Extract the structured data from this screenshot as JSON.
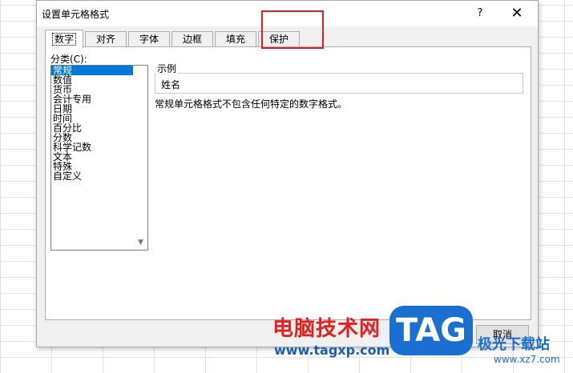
{
  "dialog": {
    "title": "设置单元格格式",
    "help": "?",
    "close": "✕"
  },
  "tabs": [
    {
      "label": "数字",
      "active": true
    },
    {
      "label": "对齐"
    },
    {
      "label": "字体"
    },
    {
      "label": "边框"
    },
    {
      "label": "填充"
    },
    {
      "label": "保护"
    }
  ],
  "category": {
    "label": "分类(C):",
    "items": [
      "常规",
      "数值",
      "货币",
      "会计专用",
      "日期",
      "时间",
      "百分比",
      "分数",
      "科学记数",
      "文本",
      "特殊",
      "自定义"
    ],
    "selected": "常规"
  },
  "sample": {
    "legend": "示例",
    "value": "姓名"
  },
  "description": "常规单元格格式不包含任何特定的数字格式。",
  "footer": {
    "cancel": "取消"
  },
  "watermark": {
    "brand": "电脑技术网",
    "url": "www.tagxp.com",
    "tag": "TAG",
    "site": "极光下载站",
    "site_url": "www.xz7.com"
  },
  "colors": {
    "selection": "#0078d7",
    "highlight": "#e02020"
  }
}
